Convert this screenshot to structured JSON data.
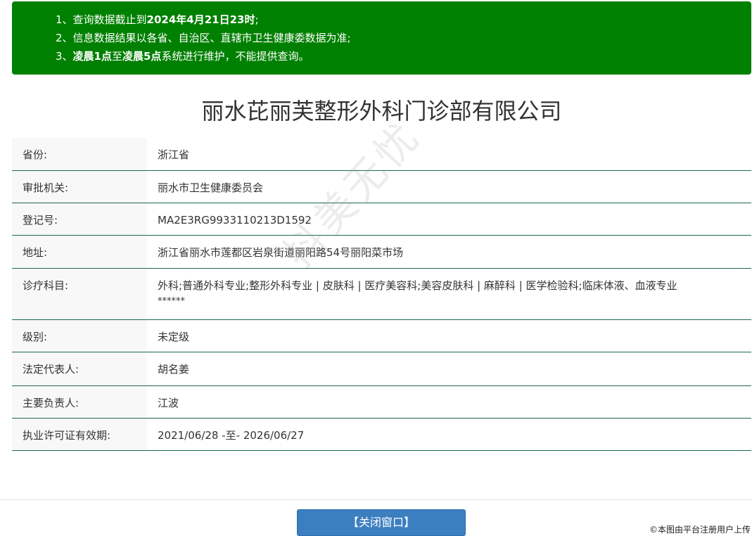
{
  "notice": {
    "line1": {
      "prefix": "1、查询数据截止到",
      "bold": "2024年4月21日23时",
      "suffix": ";"
    },
    "line2": {
      "text": "2、信息数据结果以各省、自治区、直辖市卫生健康委数据为准;"
    },
    "line3": {
      "prefix": "3、",
      "bold1": "凌晨1点",
      "mid": "至",
      "bold2": "凌晨5点",
      "suffix": "系统进行维护，不能提供查询。"
    }
  },
  "title": "丽水芘丽芙整形外科门诊部有限公司",
  "rows": [
    {
      "label": "省份:",
      "value": "浙江省"
    },
    {
      "label": "审批机关:",
      "value": "丽水市卫生健康委员会"
    },
    {
      "label": "登记号:",
      "value": "MA2E3RG9933110213D1592"
    },
    {
      "label": "地址:",
      "value": "浙江省丽水市莲都区岩泉街道丽阳路54号丽阳菜市场"
    },
    {
      "label": "诊疗科目:",
      "value": "外科;普通外科专业;整形外科专业 | 皮肤科 | 医疗美容科;美容皮肤科 | 麻醉科 | 医学检验科;临床体液、血液专业",
      "value2": "******"
    },
    {
      "label": "级别:",
      "value": "未定级"
    },
    {
      "label": "法定代表人:",
      "value": "胡名姜"
    },
    {
      "label": "主要负责人:",
      "value": "江波"
    },
    {
      "label": "执业许可证有效期:",
      "value": "2021/06/28 -至- 2026/06/27"
    }
  ],
  "watermark": "抖美无忧",
  "close_button": "【关闭窗口】",
  "copyright": "©本图由平台注册用户上传",
  "colors": {
    "notice_bg": "#008000",
    "button_bg": "#3c7fc1",
    "row_border": "#1a6b4a"
  }
}
